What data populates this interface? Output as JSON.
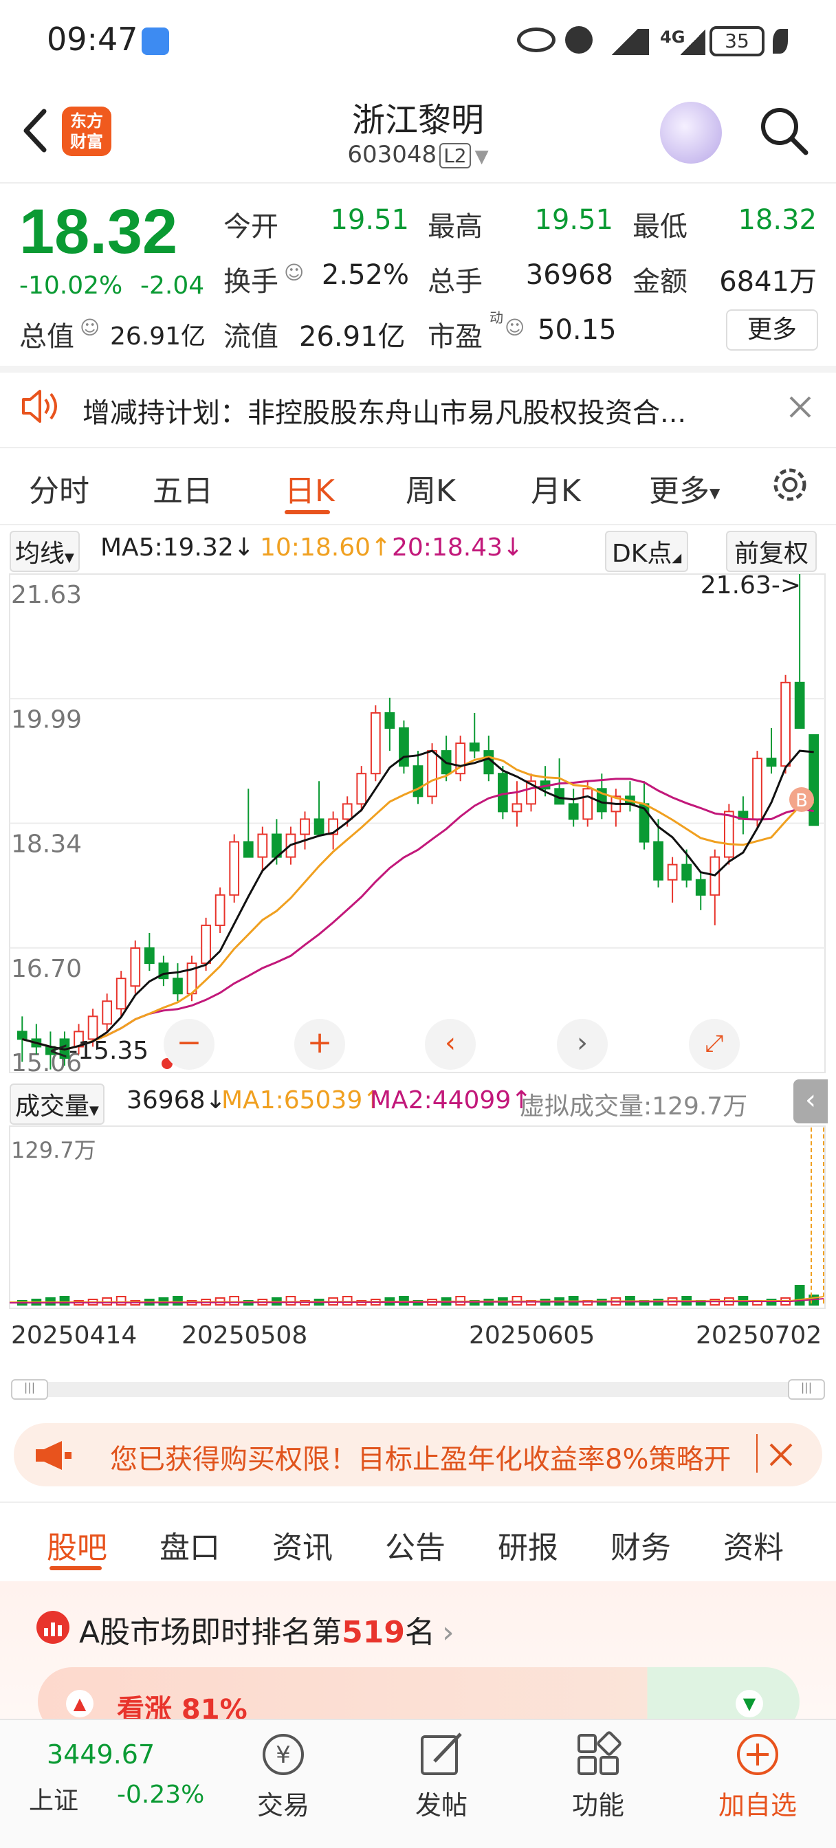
{
  "status_bar": {
    "time": "09:47",
    "network": "4G",
    "battery": "35"
  },
  "header": {
    "logo_line1": "东方",
    "logo_line2": "财富",
    "stock_name": "浙江黎明",
    "stock_code": "603048",
    "level": "L2"
  },
  "quote": {
    "price": "18.32",
    "change_pct": "-10.02%",
    "change": "-2.04",
    "open_label": "今开",
    "open": "19.51",
    "high_label": "最高",
    "high": "19.51",
    "low_label": "最低",
    "low": "18.32",
    "turnover_label": "换手",
    "turnover": "2.52%",
    "volume_label": "总手",
    "volume": "36968",
    "amount_label": "金额",
    "amount": "6841万",
    "mktcap_label": "总值",
    "mktcap": "26.91亿",
    "float_label": "流值",
    "float_cap": "26.91亿",
    "pe_label": "市盈",
    "pe_sup": "动",
    "pe": "50.15",
    "more_button": "更多"
  },
  "notice": {
    "text": "增减持计划：非控股股东舟山市易凡股权投资合..."
  },
  "tabs": [
    "分时",
    "五日",
    "日K",
    "周K",
    "月K",
    "更多"
  ],
  "active_tab": "日K",
  "ma_row": {
    "selector": "均线",
    "ma5": "MA5:19.32↓",
    "ma10": "10:18.60↑",
    "ma20": "20:18.43↓",
    "dk_button": "DK点",
    "adjust_button": "前复权"
  },
  "colors": {
    "up": "#e8342c",
    "down": "#0a9a33",
    "accent": "#e8531d",
    "ma5": "#111111",
    "ma10": "#f0a020",
    "ma20": "#c2187a"
  },
  "price_axis": {
    "labels": [
      "21.63",
      "19.99",
      "18.34",
      "16.70",
      "15.06"
    ],
    "max_marker": "21.63->",
    "min_marker": "<-15.35",
    "b_marker": "B"
  },
  "volume_row": {
    "selector": "成交量",
    "vol": "36968↓",
    "ma1": "MA1:65039↑",
    "ma2": "MA2:44099↑",
    "virtual": "虚拟成交量:129.7万",
    "axis_max": "129.7万"
  },
  "dates": [
    "20250414",
    "20250508",
    "20250605",
    "20250702"
  ],
  "promo": {
    "text": "您已获得购买权限！目标止盈年化收益率8%策略开"
  },
  "content_tabs": [
    "股吧",
    "盘口",
    "资讯",
    "公告",
    "研报",
    "财务",
    "资料"
  ],
  "active_content_tab": "股吧",
  "ranking": {
    "prefix": "A股市场即时排名第",
    "rank": "519",
    "suffix": "名",
    "bull_label": "看涨 81%"
  },
  "bottom_nav": {
    "index_value": "3449.67",
    "index_name": "上证",
    "index_change": "-0.23%",
    "items": [
      "交易",
      "发帖",
      "功能",
      "加自选"
    ]
  },
  "chart_data": {
    "type": "candlestick",
    "title": "",
    "xlabel": "",
    "ylabel": "",
    "ylim": [
      15.06,
      21.63
    ],
    "x_ticks": [
      "20250414",
      "20250508",
      "20250605",
      "20250702"
    ],
    "candles": [
      [
        15.6,
        15.8,
        15.2,
        15.5
      ],
      [
        15.5,
        15.7,
        15.3,
        15.4
      ],
      [
        15.4,
        15.6,
        15.1,
        15.3
      ],
      [
        15.5,
        15.6,
        15.15,
        15.25
      ],
      [
        15.4,
        15.7,
        15.3,
        15.6
      ],
      [
        15.5,
        15.9,
        15.4,
        15.8
      ],
      [
        15.7,
        16.1,
        15.6,
        16.0
      ],
      [
        15.9,
        16.4,
        15.8,
        16.3
      ],
      [
        16.2,
        16.8,
        16.1,
        16.7
      ],
      [
        16.7,
        16.9,
        16.4,
        16.5
      ],
      [
        16.5,
        16.6,
        16.2,
        16.3
      ],
      [
        16.3,
        16.5,
        16.0,
        16.1
      ],
      [
        16.1,
        16.6,
        16.0,
        16.5
      ],
      [
        16.5,
        17.1,
        16.4,
        17.0
      ],
      [
        17.0,
        17.5,
        16.9,
        17.4
      ],
      [
        17.4,
        18.2,
        17.3,
        18.1
      ],
      [
        18.1,
        18.8,
        17.9,
        17.9
      ],
      [
        17.9,
        18.3,
        17.7,
        18.2
      ],
      [
        18.2,
        18.4,
        17.8,
        17.9
      ],
      [
        17.9,
        18.3,
        17.8,
        18.2
      ],
      [
        18.2,
        18.5,
        18.0,
        18.4
      ],
      [
        18.4,
        18.9,
        18.2,
        18.2
      ],
      [
        18.2,
        18.5,
        18.0,
        18.4
      ],
      [
        18.4,
        18.7,
        18.3,
        18.6
      ],
      [
        18.6,
        19.1,
        18.5,
        19.0
      ],
      [
        19.0,
        19.9,
        18.9,
        19.8
      ],
      [
        19.8,
        20.0,
        19.3,
        19.6
      ],
      [
        19.6,
        19.7,
        19.0,
        19.1
      ],
      [
        19.1,
        19.3,
        18.6,
        18.7
      ],
      [
        18.7,
        19.4,
        18.6,
        19.3
      ],
      [
        19.3,
        19.5,
        18.9,
        19.0
      ],
      [
        19.0,
        19.5,
        18.9,
        19.4
      ],
      [
        19.4,
        19.8,
        19.2,
        19.3
      ],
      [
        19.3,
        19.5,
        18.9,
        19.0
      ],
      [
        19.0,
        19.1,
        18.4,
        18.5
      ],
      [
        18.5,
        18.9,
        18.3,
        18.6
      ],
      [
        18.6,
        19.0,
        18.5,
        18.9
      ],
      [
        18.9,
        19.1,
        18.7,
        18.8
      ],
      [
        18.8,
        19.2,
        18.6,
        18.6
      ],
      [
        18.6,
        18.8,
        18.3,
        18.4
      ],
      [
        18.4,
        18.9,
        18.3,
        18.8
      ],
      [
        18.8,
        19.0,
        18.4,
        18.5
      ],
      [
        18.5,
        18.8,
        18.3,
        18.7
      ],
      [
        18.7,
        18.9,
        18.5,
        18.6
      ],
      [
        18.6,
        18.9,
        18.0,
        18.1
      ],
      [
        18.1,
        18.4,
        17.5,
        17.6
      ],
      [
        17.6,
        17.9,
        17.3,
        17.8
      ],
      [
        17.8,
        18.0,
        17.5,
        17.6
      ],
      [
        17.6,
        17.7,
        17.2,
        17.4
      ],
      [
        17.4,
        18.0,
        17.0,
        17.9
      ],
      [
        17.9,
        18.6,
        17.8,
        18.5
      ],
      [
        18.5,
        18.7,
        18.2,
        18.4
      ],
      [
        18.4,
        19.3,
        18.3,
        19.2
      ],
      [
        19.2,
        19.6,
        19.0,
        19.1
      ],
      [
        19.1,
        20.3,
        19.0,
        20.2
      ],
      [
        20.2,
        21.63,
        19.6,
        19.6
      ],
      [
        19.51,
        19.51,
        18.32,
        18.32
      ]
    ]
  }
}
